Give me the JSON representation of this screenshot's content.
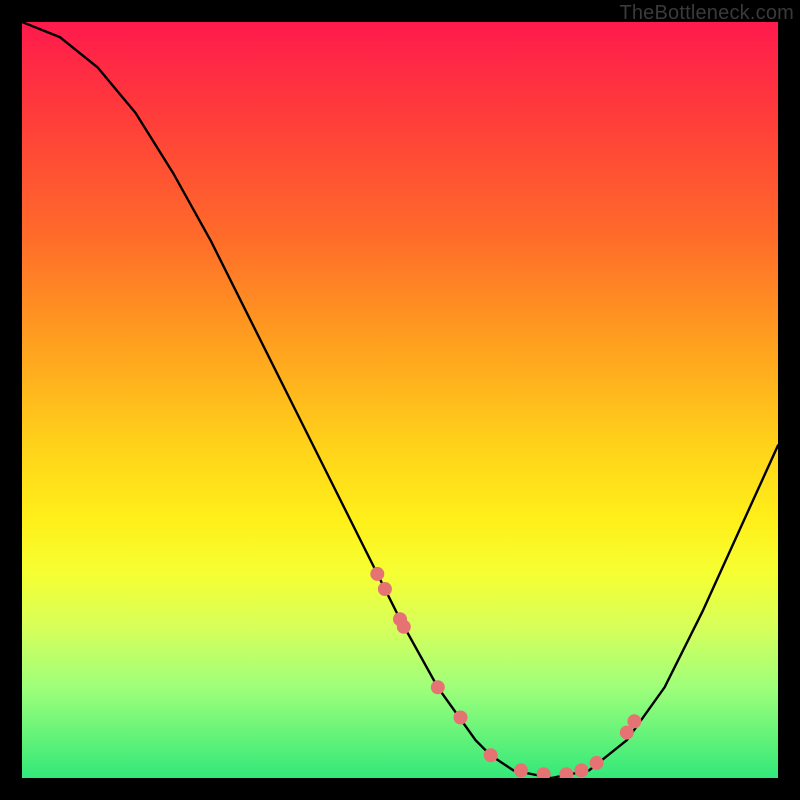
{
  "watermark": "TheBottleneck.com",
  "colors": {
    "background": "#000000",
    "curve": "#000000",
    "dots": "#e57373",
    "gradient_top": "#ff1a4d",
    "gradient_bottom": "#32e87a"
  },
  "chart_data": {
    "type": "line",
    "title": "",
    "xlabel": "",
    "ylabel": "",
    "x_range": [
      0,
      100
    ],
    "y_range": [
      0,
      100
    ],
    "curve": {
      "x": [
        0,
        5,
        10,
        15,
        20,
        25,
        30,
        35,
        40,
        45,
        50,
        55,
        60,
        62,
        65,
        70,
        75,
        80,
        85,
        90,
        95,
        100
      ],
      "y": [
        100,
        98,
        94,
        88,
        80,
        71,
        61,
        51,
        41,
        31,
        21,
        12,
        5,
        3,
        1,
        0,
        1,
        5,
        12,
        22,
        33,
        44
      ]
    },
    "series": [
      {
        "name": "markers",
        "type": "scatter",
        "x": [
          47,
          48,
          50,
          50.5,
          55,
          58,
          62,
          66,
          69,
          72,
          74,
          76,
          80,
          81
        ],
        "y": [
          27,
          25,
          21,
          20,
          12,
          8,
          3,
          1,
          0.5,
          0.5,
          1,
          2,
          6,
          7.5
        ]
      }
    ]
  }
}
